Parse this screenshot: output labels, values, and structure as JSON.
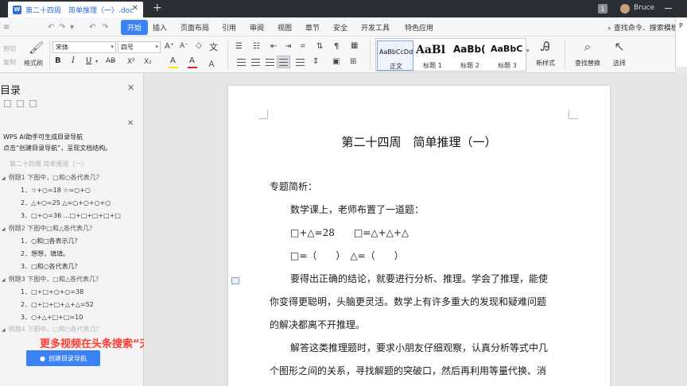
{
  "titlebar": {
    "tab_title": "第二十四周　简单推理（一）.doc",
    "tab_app_badge": "W",
    "badge_number": "1",
    "user_name": "Bruce"
  },
  "menu": {
    "items": [
      "文件",
      "开始",
      "插入",
      "页面布局",
      "引用",
      "审阅",
      "视图",
      "章节",
      "安全",
      "开发工具",
      "特色应用"
    ],
    "active": "开始",
    "search_command": "查找命令、搜索模板",
    "panel_edge_label": "P"
  },
  "ribbon": {
    "cut": "剪切",
    "copy": "复制",
    "format_painter": "格式刷",
    "font_name": "宋体",
    "font_size": "四号",
    "bold": "B",
    "italic": "I",
    "underline": "U",
    "highlight_letter": "A",
    "font_color_letter": "A",
    "styles": [
      {
        "preview": "AaBbCcDd",
        "name": "正文"
      },
      {
        "preview": "AaBl",
        "name": "标题 1"
      },
      {
        "preview": "AaBb(",
        "name": "标题 2"
      },
      {
        "preview": "AaBbC",
        "name": "标题 3"
      }
    ],
    "new_style": "新样式",
    "find_replace": "查找替换",
    "select": "选择",
    "accent_color": "#3b82f6"
  },
  "outline_panel": {
    "title": "目录",
    "tip_line1": "WPS AI助手可生成目录导航",
    "tip_line2": "点击“创建目录导航”，呈现文档结构。",
    "items": [
      {
        "text": "第二十四周  简单推理（一）",
        "level": 0,
        "faded": true
      },
      {
        "text": "例题1  下图中，□和○各代表几？",
        "level": 1
      },
      {
        "text": "1．☆+○=18    ☆=○+○",
        "level": 2
      },
      {
        "text": "2．△+○=25    △=○+○+○+○",
        "level": 2
      },
      {
        "text": "3．□+○=36   ...□+□+□+□+□",
        "level": 2
      },
      {
        "text": "例题2  下图中□和△各代表几？",
        "level": 1
      },
      {
        "text": "1．○和□各表示几？",
        "level": 2
      },
      {
        "text": "2．想想，填填。",
        "level": 2
      },
      {
        "text": "3．□和○各代表几？",
        "level": 2
      },
      {
        "text": "例题3  下图中，□和△各代表几？",
        "level": 1
      },
      {
        "text": "1．□+□+○+○=38",
        "level": 2
      },
      {
        "text": "2．□+□+□+△+△=52",
        "level": 2
      },
      {
        "text": "3．○+△+□+□=10",
        "level": 2
      },
      {
        "text": "例题4  下图中，□和○各代表几？",
        "level": 1,
        "faded": true
      }
    ],
    "promo": "更多视频在头条搜索“天才奥数”。",
    "create_nav_button": "创建目录导航",
    "promo_color": "#ff3b30"
  },
  "document": {
    "title": "第二十四周　简单推理（一）",
    "lines": [
      "专题简析：",
      "数学课上，老师布置了一道题：",
      "□+△=28　　□=△+△+△",
      "□=（　　）　△=（　　）",
      "要得出正确的结论，就要进行分析、推理。学会了推理，能使",
      "你变得更聪明，头脑更灵活。数学上有许多重大的发现和疑难问题",
      "的解决都离不开推理。",
      "解答这类推理题时，要求小朋友仔细观察，认真分析等式中几",
      "个图形之间的关系，寻找解题的突破口，然后再利用等量代换、消"
    ]
  }
}
